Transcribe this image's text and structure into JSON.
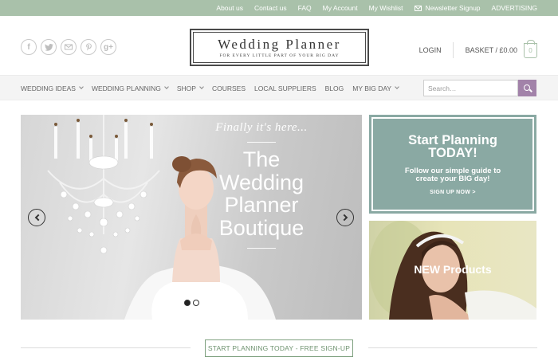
{
  "topbar": {
    "links": [
      {
        "label": "About us"
      },
      {
        "label": "Contact us"
      },
      {
        "label": "FAQ"
      },
      {
        "label": "My Account"
      },
      {
        "label": "My Wishlist"
      },
      {
        "label": "Newsletter Signup",
        "icon": "mail-icon"
      },
      {
        "label": "ADVERTISING"
      }
    ]
  },
  "header": {
    "social": [
      {
        "icon": "facebook-icon",
        "glyph": "f"
      },
      {
        "icon": "twitter-icon",
        "glyph": "t"
      },
      {
        "icon": "email-icon",
        "glyph": "✉"
      },
      {
        "icon": "pinterest-icon",
        "glyph": "p"
      },
      {
        "icon": "google-plus-icon",
        "glyph": "g+"
      }
    ],
    "logo": {
      "title": "Wedding Planner",
      "tagline": "FOR EVERY LITTLE PART OF YOUR BIG DAY"
    },
    "login_label": "LOGIN",
    "basket_label": "BASKET / £0.00",
    "cart_count": "0"
  },
  "nav": {
    "items": [
      {
        "label": "WEDDING IDEAS",
        "has_dropdown": true
      },
      {
        "label": "WEDDING PLANNING",
        "has_dropdown": true
      },
      {
        "label": "SHOP",
        "has_dropdown": true
      },
      {
        "label": "COURSES",
        "has_dropdown": false
      },
      {
        "label": "LOCAL SUPPLIERS",
        "has_dropdown": false
      },
      {
        "label": "BLOG",
        "has_dropdown": false
      },
      {
        "label": "MY BIG DAY",
        "has_dropdown": true
      }
    ],
    "search_placeholder": "Search…"
  },
  "hero": {
    "script_text": "Finally it's here...",
    "headline": [
      "The",
      "Wedding",
      "Planner",
      "Boutique"
    ],
    "slides_total": 2,
    "active_slide": 1
  },
  "promo_planning": {
    "heading_1": "Start Planning",
    "heading_2": "TODAY!",
    "text": "Follow our simple guide to create your BIG day!",
    "cta": "SIGN UP NOW >"
  },
  "promo_products": {
    "label": "NEW Products"
  },
  "footer": {
    "signup_button": "START PLANNING TODAY - FREE SIGN-UP"
  },
  "colors": {
    "topbar": "#a9c1aa",
    "accent_purple": "#a282a9",
    "promo_teal": "#8aa9a3",
    "signup_green": "#7ea07f"
  }
}
